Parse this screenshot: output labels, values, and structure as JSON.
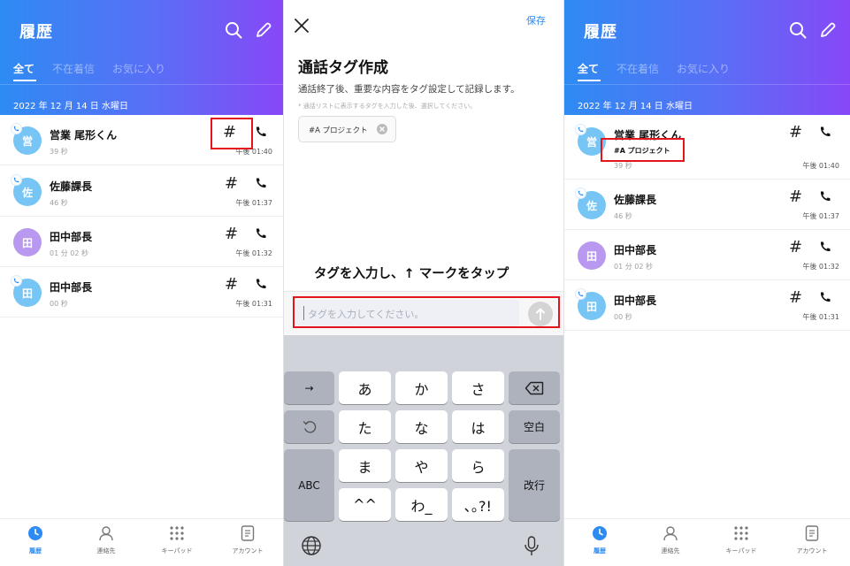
{
  "colors": {
    "accent": "#2e8bf3",
    "gradient_end": "#8847f7",
    "highlight": "#e5141c",
    "avatar_blue": "#76c5f5",
    "avatar_purple": "#b899ef"
  },
  "history": {
    "title": "履歴",
    "tabs": [
      "全て",
      "不在着信",
      "お気に入り"
    ],
    "date": "2022 年 12 月 14 日 水曜日",
    "calls": [
      {
        "avatar": "営",
        "name": "営業 尾形くん",
        "duration": "39 秒",
        "time": "午後 01:40",
        "avatar_color": "blue",
        "incoming_badge": true,
        "tag": "#A プロジェクト"
      },
      {
        "avatar": "佐",
        "name": "佐藤課長",
        "duration": "46 秒",
        "time": "午後 01:37",
        "avatar_color": "blue",
        "incoming_badge": true
      },
      {
        "avatar": "田",
        "name": "田中部長",
        "duration": "01 分 02 秒",
        "time": "午後 01:32",
        "avatar_color": "purple",
        "incoming_badge": false
      },
      {
        "avatar": "田",
        "name": "田中部長",
        "duration": "00 秒",
        "time": "午後 01:31",
        "avatar_color": "blue",
        "incoming_badge": true
      }
    ],
    "tag_button": "#"
  },
  "nav": [
    {
      "label": "履歴",
      "icon": "clock-icon",
      "active": true
    },
    {
      "label": "連絡先",
      "icon": "person-icon",
      "active": false
    },
    {
      "label": "キーパッド",
      "icon": "keypad-icon",
      "active": false
    },
    {
      "label": "アカウント",
      "icon": "document-icon",
      "active": false
    }
  ],
  "tag_editor": {
    "save": "保存",
    "title": "通話タグ作成",
    "description": "通話終了後、重要な内容をタグ設定して記録します。",
    "note": "* 通話リストに表示するタグを入力した後、選択してください。",
    "chip": "#A プロジェクト",
    "instruction": "タグを入力し、↑ マークをタップ",
    "input_placeholder": "タグを入力してください。"
  },
  "keyboard": {
    "row1": [
      "→",
      "あ",
      "か",
      "さ"
    ],
    "row2": [
      "た",
      "な",
      "は"
    ],
    "row3": [
      "ま",
      "や",
      "ら"
    ],
    "row4": [
      "^^",
      "わ_",
      "､｡?!"
    ],
    "space": "空白",
    "abc": "ABC",
    "enter": "改行"
  }
}
